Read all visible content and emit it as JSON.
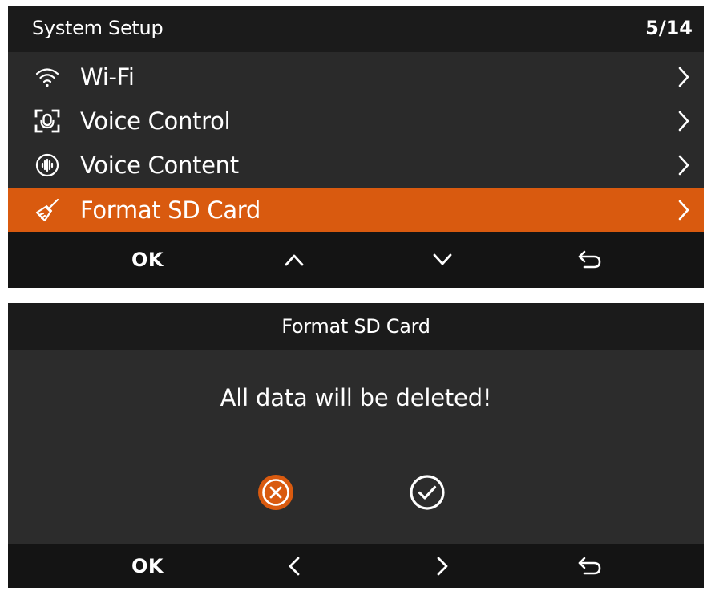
{
  "system_setup": {
    "title": "System Setup",
    "page_indicator": "5/14",
    "items": [
      {
        "label": "Wi-Fi",
        "icon": "wifi-icon",
        "selected": false
      },
      {
        "label": "Voice Control",
        "icon": "voice-control-icon",
        "selected": false
      },
      {
        "label": "Voice Content",
        "icon": "voice-content-icon",
        "selected": false
      },
      {
        "label": "Format SD Card",
        "icon": "broom-icon",
        "selected": true
      }
    ],
    "footer": {
      "ok_label": "OK",
      "icons": [
        "chevron-up-icon",
        "chevron-down-icon",
        "back-icon"
      ]
    }
  },
  "format_dialog": {
    "title": "Format SD Card",
    "message": "All data will be deleted!",
    "buttons": [
      {
        "name": "cancel",
        "icon": "cancel-circle-icon",
        "selected": true
      },
      {
        "name": "confirm",
        "icon": "check-circle-icon",
        "selected": false
      }
    ],
    "footer": {
      "ok_label": "OK",
      "icons": [
        "chevron-left-icon",
        "chevron-right-icon",
        "back-icon"
      ]
    }
  },
  "colors": {
    "accent": "#d95a0f",
    "panel": "#2a2a2a",
    "header": "#1b1b1b",
    "footer": "#141414",
    "text": "#ffffff"
  }
}
